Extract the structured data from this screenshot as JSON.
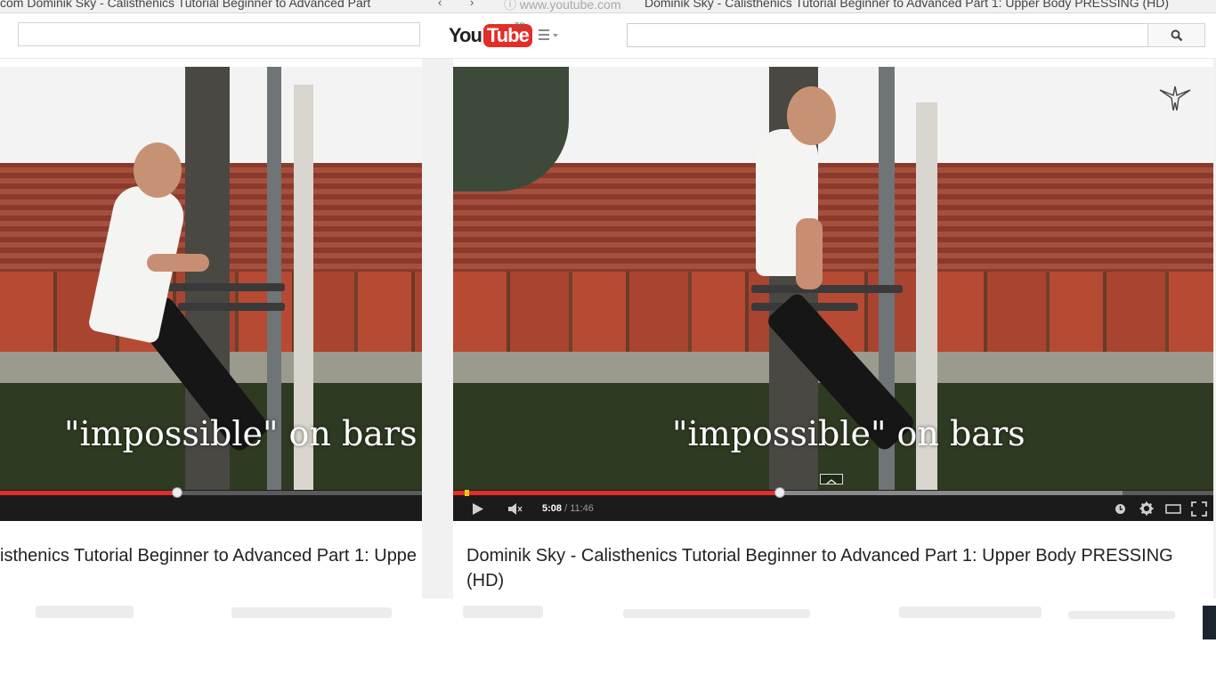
{
  "browser": {
    "left_tab_text": "com    Dominik Sky - Calisthenics Tutorial Beginner to Advanced Part",
    "address_text": "www.youtube.com",
    "right_tab_text": "Dominik Sky - Calisthenics Tutorial Beginner to Advanced Part 1: Upper Body PRESSING (HD)"
  },
  "header": {
    "logo_you": "You",
    "logo_tube": "Tube",
    "region": "TR",
    "search_value": "",
    "icons": {
      "guide": "hamburger-menu-icon",
      "search": "magnifier-icon"
    }
  },
  "left_player": {
    "caption": "\"impossible\" on bars",
    "progress_fraction": 0.42,
    "title": "isthenics Tutorial Beginner to Advanced Part 1: Uppe"
  },
  "right_player": {
    "caption": "\"impossible\" on bars",
    "progress_fraction": 0.43,
    "buffer_fraction": 0.88,
    "time_current": "5:08",
    "time_separator": " / ",
    "time_total": "11:46",
    "title": "Dominik Sky - Calisthenics Tutorial Beginner to Advanced Part 1: Upper Body PRESSING (HD)",
    "controls": [
      "play-icon",
      "volume-icon",
      "watch-later-icon",
      "settings-gear-icon",
      "theater-mode-icon",
      "fullscreen-icon"
    ]
  },
  "colors": {
    "youtube_red": "#e52d27",
    "control_bar": "#1b1b1b",
    "progress_played": "#e52d27"
  }
}
